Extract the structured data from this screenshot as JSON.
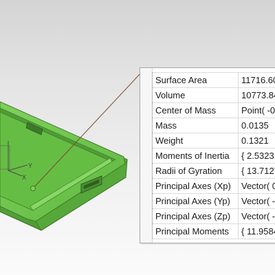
{
  "colors": {
    "part_green": "#6cc24a",
    "part_edge": "#3f7a2a",
    "leader_line": "#7a4a2a",
    "background_top": "#d4d4d4",
    "background_bottom": "#fbfbfb"
  },
  "triad": {
    "x_label": "X",
    "y_label": "Y"
  },
  "properties": [
    {
      "name": "Surface Area",
      "value": "11716.60"
    },
    {
      "name": "Volume",
      "value": "10773.84"
    },
    {
      "name": "Center of Mass",
      "value": "Point( -0"
    },
    {
      "name": "Mass",
      "value": "0.0135"
    },
    {
      "name": "Weight",
      "value": "0.1321"
    },
    {
      "name": "Moments of Inertia",
      "value": "{ 2.5323,"
    },
    {
      "name": "Radii of Gyration",
      "value": "{ 13.7127"
    },
    {
      "name": "Principal Axes (Xp)",
      "value": "Vector( 0"
    },
    {
      "name": "Principal Axes (Yp)",
      "value": "Vector( -"
    },
    {
      "name": "Principal Axes (Zp)",
      "value": "Vector( -"
    },
    {
      "name": "Principal Moments",
      "value": "{ 11.9584"
    }
  ]
}
